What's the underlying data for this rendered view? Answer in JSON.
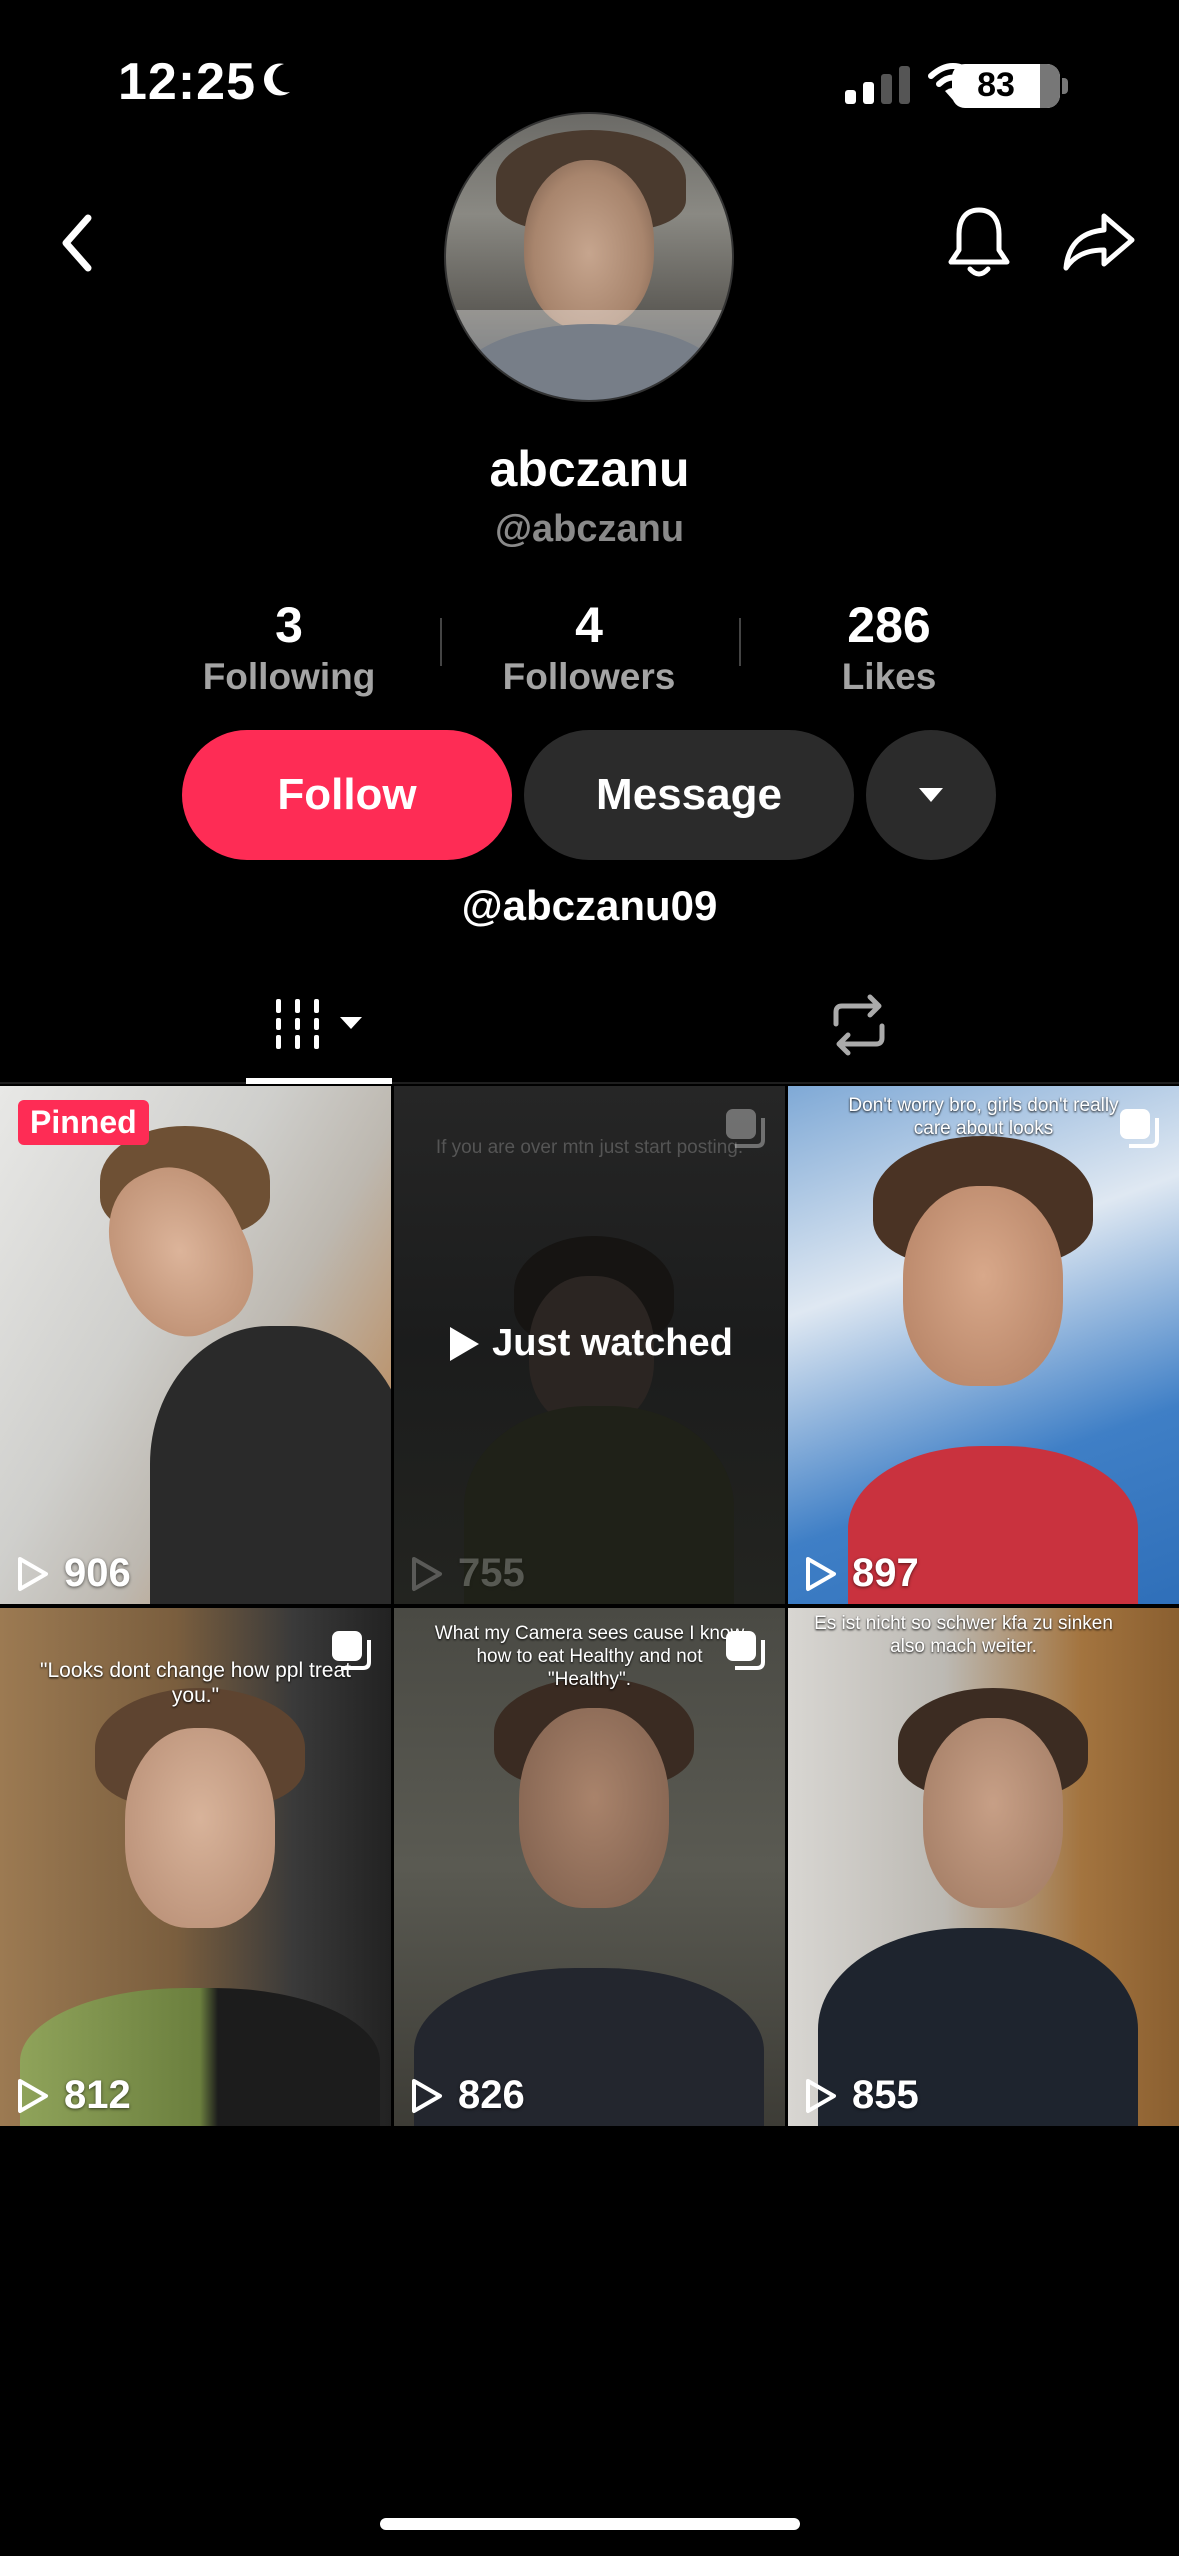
{
  "status_bar": {
    "time": "12:25",
    "battery": "83"
  },
  "profile": {
    "display_name": "abczanu",
    "username": "@abczanu",
    "stats": [
      {
        "value": "3",
        "label": "Following"
      },
      {
        "value": "4",
        "label": "Followers"
      },
      {
        "value": "286",
        "label": "Likes"
      }
    ],
    "buttons": {
      "follow": "Follow",
      "message": "Message"
    },
    "bio_link": "@abczanu09"
  },
  "icons": {
    "back": "chevron-left-icon",
    "bell": "bell-icon",
    "share": "share-arrow-icon",
    "grid_tab": "video-grid-icon",
    "repost_tab": "repost-icon"
  },
  "colors": {
    "accent": "#fe2c55",
    "secondary_button": "#2b2b2b"
  },
  "videos": [
    {
      "views": "906",
      "badge": "Pinned",
      "caption": ""
    },
    {
      "views": "755",
      "overlay": "Just watched",
      "caption": "If you are over mtn just start posting."
    },
    {
      "views": "897",
      "caption": "Don't worry bro, girls don't really care about looks"
    },
    {
      "views": "812",
      "caption": "\"Looks dont change how ppl treat you.\""
    },
    {
      "views": "826",
      "caption": "What my Camera sees cause I know how to eat Healthy and not \"Healthy\"."
    },
    {
      "views": "855",
      "caption": "Es ist nicht so schwer kfa zu sinken also mach weiter."
    }
  ]
}
